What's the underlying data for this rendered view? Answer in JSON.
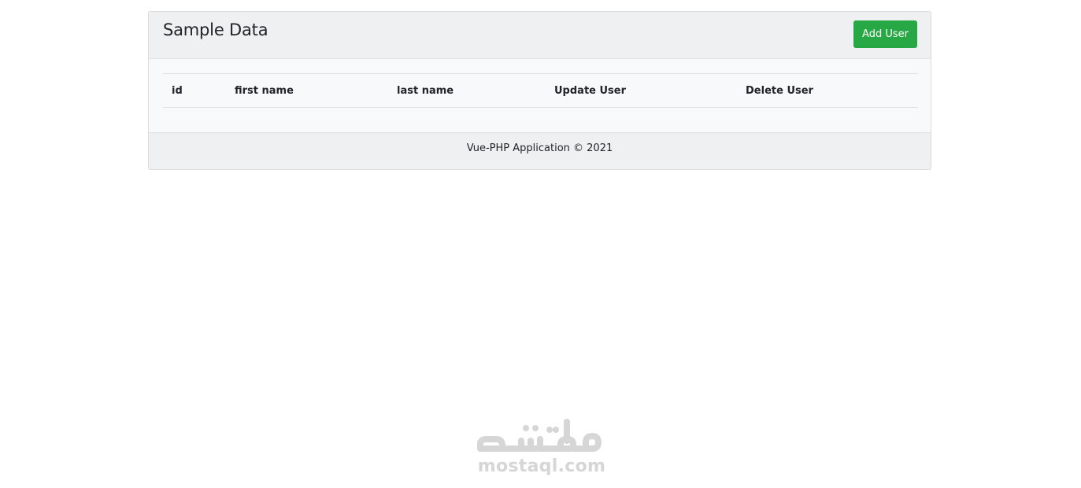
{
  "card": {
    "title": "Sample Data",
    "add_button_label": "Add User"
  },
  "table": {
    "columns": [
      "id",
      "first name",
      "last name",
      "Update User",
      "Delete User"
    ],
    "rows": []
  },
  "footer": {
    "text": "Vue-PHP Application © 2021"
  },
  "watermark": {
    "arabic": "مستقل",
    "latin": "mostaql.com"
  },
  "colors": {
    "add_button": "#28a745",
    "header_bg": "#eff0f2",
    "body_bg": "#f8f9fa",
    "watermark": "#d6d6d6"
  }
}
